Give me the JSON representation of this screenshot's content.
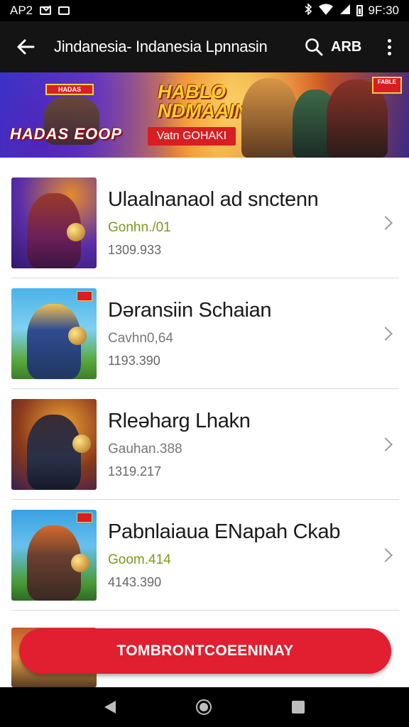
{
  "status_bar": {
    "left_text": "AP2",
    "time": "9F:30"
  },
  "app_bar": {
    "title": "Jindanesia- Indanesia Lpnnasin",
    "action_label": "ARB"
  },
  "banner": {
    "badge_text": "HADAS",
    "left_text": "HADAS EOOP",
    "title": "HABLO NDMAAIN",
    "button_label": "Vatn GOHAKI",
    "corner_logo": "FABLE"
  },
  "games": [
    {
      "name": "Ulaalnanaol ad snctenn",
      "subtitle": "Gonhn./01",
      "subtitle_color": "#7a9a1a",
      "meta": "1309.933"
    },
    {
      "name": "Dəransiin Schaian",
      "subtitle": "Cavhn0,64",
      "subtitle_color": "#777777",
      "meta": "1193.390"
    },
    {
      "name": "Rleəharg Lhakn",
      "subtitle": "Gauhan.388",
      "subtitle_color": "#777777",
      "meta": "1319.217"
    },
    {
      "name": "Pabnlaiaua ENapah Ckab",
      "subtitle": "Goom.414",
      "subtitle_color": "#7a9a1a",
      "meta": "4143.390"
    }
  ],
  "cta": {
    "label": "TOMBRONTCOEENINAY",
    "color": "#e21e31"
  }
}
